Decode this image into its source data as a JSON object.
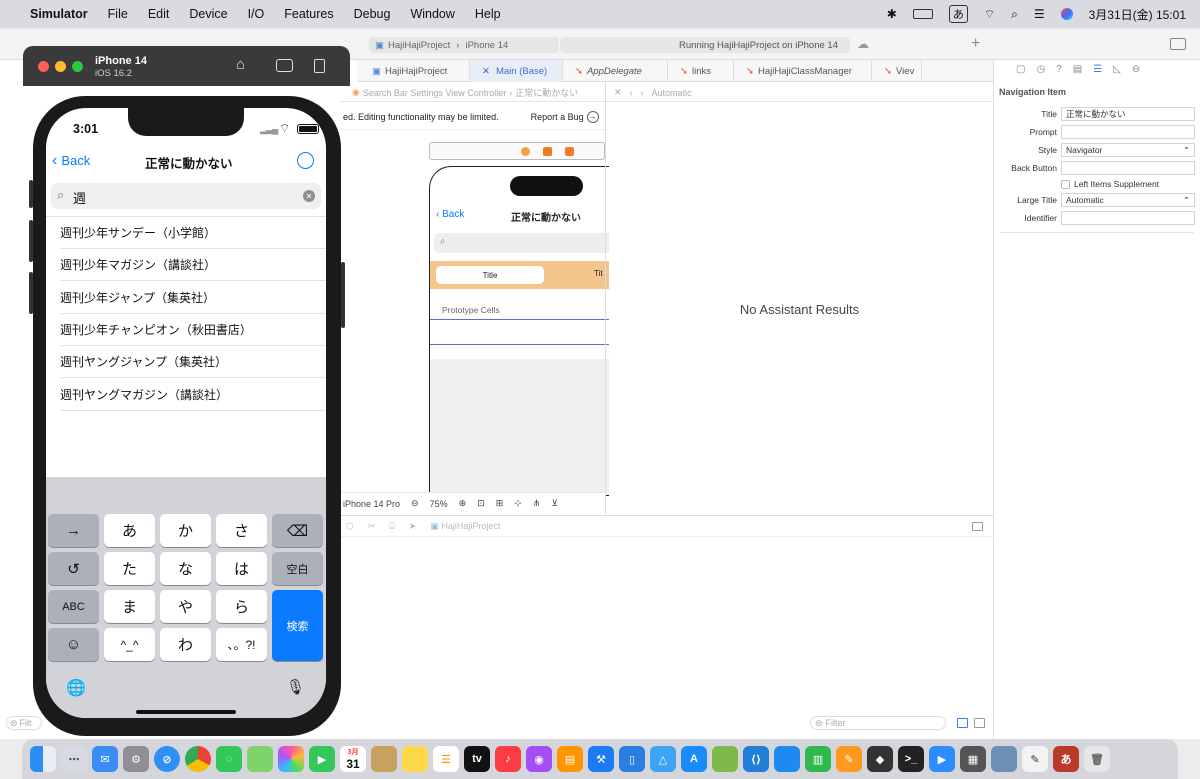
{
  "menubar": {
    "app": "Simulator",
    "items": [
      "File",
      "Edit",
      "Device",
      "I/O",
      "Features",
      "Debug",
      "Window",
      "Help"
    ],
    "ime": "あ",
    "datetime": "3月31日(金)  15:01"
  },
  "xcode": {
    "project": "HajiHajiProject",
    "device": "iPhone 14",
    "status": "Running HajiHajiProject on iPhone 14",
    "tabs": [
      "HajiHajiProject",
      "Main (Base)",
      "AppDelegate",
      "links",
      "HajiHajiClassManager",
      "Viev"
    ],
    "breadcrumb": "Search Bar Settings View Controller",
    "breadcrumb2": "正常に動かない",
    "assistant_mode": "Automatic",
    "banner": "ed. Editing functionality may be limited.",
    "report_bug": "Report a Bug",
    "canvas": {
      "back": "Back",
      "title": "正常に動かない",
      "segment_left": "Title",
      "segment_right": "Tit",
      "prototype": "Prototype Cells"
    },
    "device_label": "iPhone 14 Pro",
    "zoom": "75%",
    "debug_project": "HajiHajiProject",
    "no_results": "No Assistant Results",
    "filter": "Filter",
    "filter_left": "Filt",
    "inspector": {
      "header": "Navigation Item",
      "title_label": "Title",
      "title_value": "正常に動かない",
      "prompt_label": "Prompt",
      "style_label": "Style",
      "style_value": "Navigator",
      "back_label": "Back Button",
      "left_items": "Left Items Supplement",
      "large_title_label": "Large Title",
      "large_title_value": "Automatic",
      "identifier_label": "Identifier"
    }
  },
  "simulator": {
    "device": "iPhone 14",
    "os": "iOS 16.2"
  },
  "phone": {
    "time": "3:01",
    "back": "Back",
    "nav_title": "正常に動かない",
    "search_text": "週",
    "results": [
      "週刊少年サンデー（小学館）",
      "週刊少年マガジン（講談社）",
      "週刊少年ジャンプ（集英社）",
      "週刊少年チャンピオン（秋田書店）",
      "週刊ヤングジャンプ（集英社）",
      "週刊ヤングマガジン（講談社）"
    ],
    "keys": {
      "arrow": "→",
      "a": "あ",
      "ka": "か",
      "sa": "さ",
      "ta": "た",
      "na": "な",
      "ha": "は",
      "space": "空白",
      "undo": "↺",
      "abc": "ABC",
      "ma": "ま",
      "ya": "や",
      "ra": "ら",
      "search": "検索",
      "emoji": "☺",
      "face": "^_^",
      "wa": "わ",
      "punct": "、。?!",
      "globe": "🌐",
      "mic": "🎙"
    }
  },
  "dock": {
    "calendar_month": "3月",
    "calendar_day": "31",
    "tv": "tv",
    "ime": "あ"
  },
  "colors": {
    "ios_blue": "#0a7aff",
    "xcode_orange": "#f5a142"
  }
}
